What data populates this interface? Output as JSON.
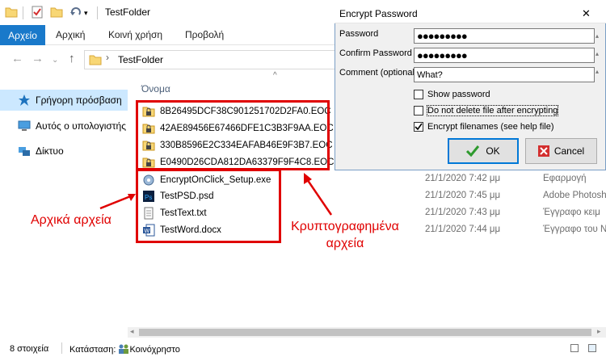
{
  "window": {
    "title": "TestFolder"
  },
  "ribbon": {
    "tabs": [
      "Αρχείο",
      "Αρχική",
      "Κοινή χρήση",
      "Προβολή"
    ]
  },
  "address": {
    "path": "TestFolder"
  },
  "nav": {
    "items": [
      "Γρήγορη πρόσβαση",
      "Αυτός ο υπολογιστής",
      "Δίκτυο"
    ]
  },
  "file_list": {
    "column_name": "Όνομα",
    "encrypted_files": [
      "8B26495DCF38C901251702D2FA0.EOC",
      "42AE89456E67466DFE1C3B3F9AA.EOC",
      "330B8596E2C334EAFAB46E9F3B7.EOC",
      "E0490D26CDA812DA63379F9F4C8.EOC"
    ],
    "original_files": [
      {
        "name": "EncryptOnClick_Setup.exe",
        "date": "21/1/2020 7:42 μμ",
        "type": "Εφαρμογή",
        "icon": "setup-icon"
      },
      {
        "name": "TestPSD.psd",
        "date": "21/1/2020 7:45 μμ",
        "type": "Adobe Photosh",
        "icon": "photoshop-icon"
      },
      {
        "name": "TestText.txt",
        "date": "21/1/2020 7:43 μμ",
        "type": "Έγγραφο κειμ",
        "icon": "text-file-icon"
      },
      {
        "name": "TestWord.docx",
        "date": "21/1/2020 7:44 μμ",
        "type": "Έγγραφο του Ν",
        "icon": "word-icon"
      }
    ]
  },
  "annotations": {
    "original_label": "Αρχικά αρχεία",
    "encrypted_label_line1": "Κρυπτογραφημένα",
    "encrypted_label_line2": "αρχεία",
    "color": "#e00000"
  },
  "status": {
    "count": "8 στοιχεία",
    "state": "Κατάσταση:",
    "state_value": "Κοινόχρηστο"
  },
  "dialog": {
    "title": "Encrypt Password",
    "password_label": "Password",
    "password_value": "●●●●●●●●●",
    "confirm_label": "Confirm Password",
    "confirm_value": "●●●●●●●●●",
    "comment_label": "Comment (optional)",
    "comment_value": "What?",
    "show_password": {
      "label": "Show password",
      "checked": false
    },
    "do_not_delete": {
      "label": "Do not delete file after encrypting",
      "checked": false
    },
    "encrypt_filenames": {
      "label": "Encrypt filenames (see help file)",
      "checked": true
    },
    "ok_label": "OK",
    "cancel_label": "Cancel"
  },
  "colors": {
    "accent": "#1979ca",
    "selection": "#cce8ff",
    "folder": "#f8d775"
  }
}
